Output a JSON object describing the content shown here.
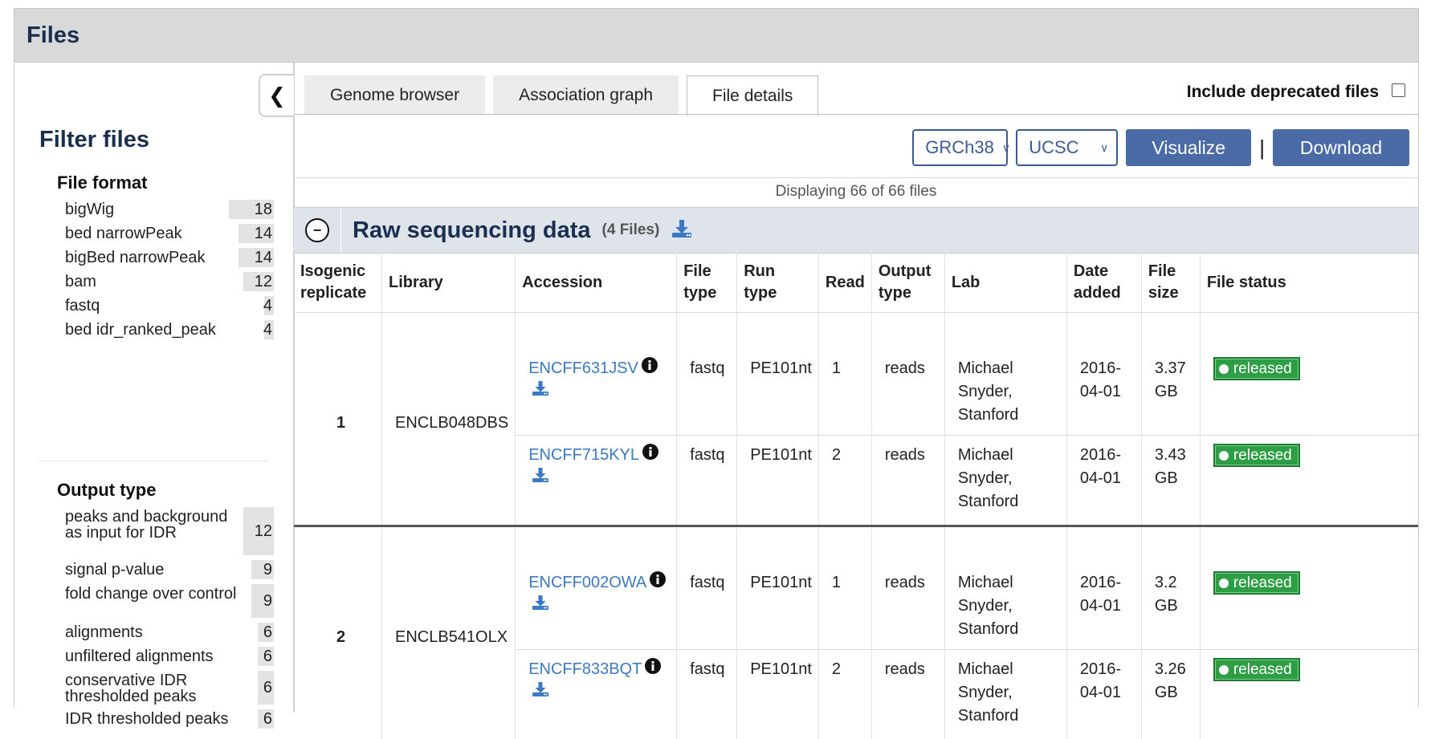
{
  "panel": {
    "title": "Files"
  },
  "sidebar": {
    "filter_title": "Filter files",
    "file_format": {
      "title": "File format",
      "items": [
        {
          "label": "bigWig",
          "count": "18"
        },
        {
          "label": "bed narrowPeak",
          "count": "14"
        },
        {
          "label": "bigBed narrowPeak",
          "count": "14"
        },
        {
          "label": "bam",
          "count": "12"
        },
        {
          "label": "fastq",
          "count": "4"
        },
        {
          "label": "bed idr_ranked_peak",
          "count": "4"
        }
      ]
    },
    "output_type": {
      "title": "Output type",
      "items": [
        {
          "label": "peaks and background as input for IDR",
          "count": "12"
        },
        {
          "label": "signal p-value",
          "count": "9"
        },
        {
          "label": "fold change over control",
          "count": "9"
        },
        {
          "label": "alignments",
          "count": "6"
        },
        {
          "label": "unfiltered alignments",
          "count": "6"
        },
        {
          "label": "conservative IDR thresholded peaks",
          "count": "6"
        },
        {
          "label": "IDR thresholded peaks",
          "count": "6"
        }
      ]
    }
  },
  "tabs": [
    {
      "label": "Genome browser",
      "active": false
    },
    {
      "label": "Association graph",
      "active": false
    },
    {
      "label": "File details",
      "active": true
    }
  ],
  "deprecated_label": "Include deprecated files",
  "controls": {
    "assembly": "GRCh38",
    "browser": "UCSC",
    "visualize": "Visualize",
    "separator": "|",
    "download": "Download"
  },
  "displaying": "Displaying 66 of 66 files",
  "section": {
    "title": "Raw sequencing data",
    "count": "(4 Files)",
    "toggle": "−"
  },
  "columns": [
    "Isogenic replicate",
    "Library",
    "Accession",
    "File type",
    "Run type",
    "Read",
    "Output type",
    "Lab",
    "Date added",
    "File size",
    "File status"
  ],
  "groups": [
    {
      "replicate": "1",
      "library": "ENCLB048DBS",
      "files": [
        {
          "accession": "ENCFF631JSV",
          "file_type": "fastq",
          "run_type": "PE101nt",
          "read": "1",
          "output_type": "reads",
          "lab": "Michael Snyder, Stanford",
          "date": "2016-04-01",
          "size": "3.37 GB",
          "status": "released"
        },
        {
          "accession": "ENCFF715KYL",
          "file_type": "fastq",
          "run_type": "PE101nt",
          "read": "2",
          "output_type": "reads",
          "lab": "Michael Snyder, Stanford",
          "date": "2016-04-01",
          "size": "3.43 GB",
          "status": "released"
        }
      ]
    },
    {
      "replicate": "2",
      "library": "ENCLB541OLX",
      "files": [
        {
          "accession": "ENCFF002OWA",
          "file_type": "fastq",
          "run_type": "PE101nt",
          "read": "1",
          "output_type": "reads",
          "lab": "Michael Snyder, Stanford",
          "date": "2016-04-01",
          "size": "3.2 GB",
          "status": "released"
        },
        {
          "accession": "ENCFF833BQT",
          "file_type": "fastq",
          "run_type": "PE101nt",
          "read": "2",
          "output_type": "reads",
          "lab": "Michael Snyder, Stanford",
          "date": "2016-04-01",
          "size": "3.26 GB",
          "status": "released"
        }
      ]
    }
  ]
}
